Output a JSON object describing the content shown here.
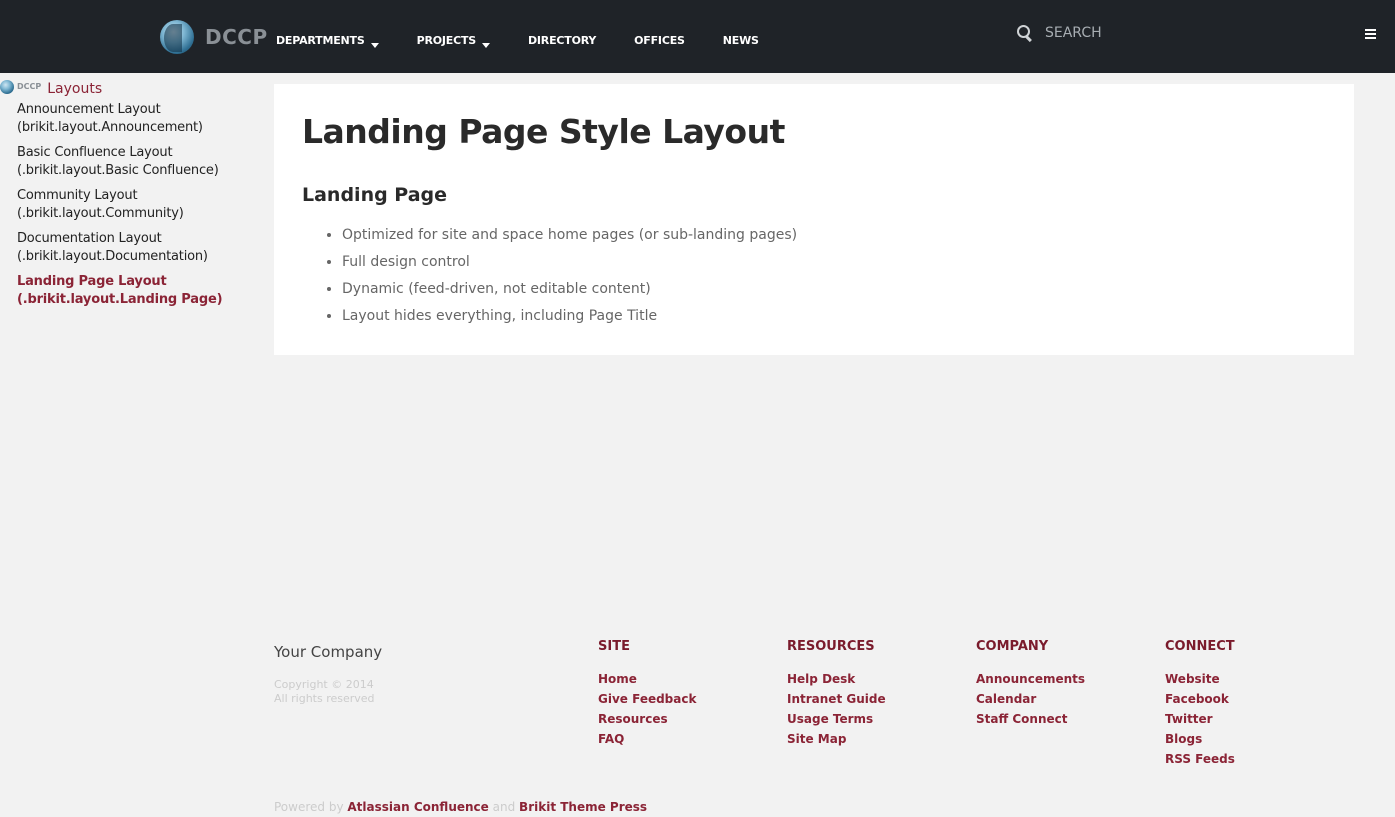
{
  "header": {
    "logo_text": "DCCP",
    "nav": [
      {
        "label": "DEPARTMENTS",
        "dropdown": true
      },
      {
        "label": "PROJECTS",
        "dropdown": true
      },
      {
        "label": "DIRECTORY",
        "dropdown": false
      },
      {
        "label": "OFFICES",
        "dropdown": false
      },
      {
        "label": "NEWS",
        "dropdown": false
      }
    ],
    "search_placeholder": "SEARCH"
  },
  "sidebar": {
    "mini_logo_text": "DCCP",
    "title": "Layouts",
    "items": [
      {
        "label": "Announcement Layout (brikit.layout.Announcement)",
        "active": false
      },
      {
        "label": "Basic Confluence Layout (.brikit.layout.Basic Confluence)",
        "active": false
      },
      {
        "label": "Community Layout (.brikit.layout.Community)",
        "active": false
      },
      {
        "label": "Documentation Layout (.brikit.layout.Documentation)",
        "active": false
      },
      {
        "label": "Landing Page Layout (.brikit.layout.Landing Page)",
        "active": true
      }
    ]
  },
  "main": {
    "title": "Landing Page Style Layout",
    "section_heading": "Landing Page",
    "bullets": [
      "Optimized for site and space home pages (or sub-landing pages)",
      "Full design control",
      "Dynamic (feed-driven, not editable content)",
      "Layout hides everything, including Page Title"
    ]
  },
  "footer": {
    "company": "Your Company",
    "copyright": "Copyright © 2014",
    "rights": "All rights reserved",
    "columns": [
      {
        "heading": "SITE",
        "links": [
          "Home",
          "Give Feedback",
          "Resources",
          "FAQ"
        ]
      },
      {
        "heading": "RESOURCES",
        "links": [
          "Help Desk",
          "Intranet Guide",
          "Usage Terms",
          "Site Map"
        ]
      },
      {
        "heading": "COMPANY",
        "links": [
          "Announcements",
          "Calendar",
          "Staff Connect"
        ]
      },
      {
        "heading": "CONNECT",
        "links": [
          "Website",
          "Facebook",
          "Twitter",
          "Blogs",
          "RSS Feeds"
        ]
      }
    ],
    "powered_by": "Powered by",
    "powered_link_1": "Atlassian Confluence",
    "powered_and": "and",
    "powered_link_2": "Brikit Theme Press"
  },
  "colors": {
    "header_bg": "#1f2328",
    "accent": "#8b2436",
    "page_bg": "#f2f2f2"
  }
}
